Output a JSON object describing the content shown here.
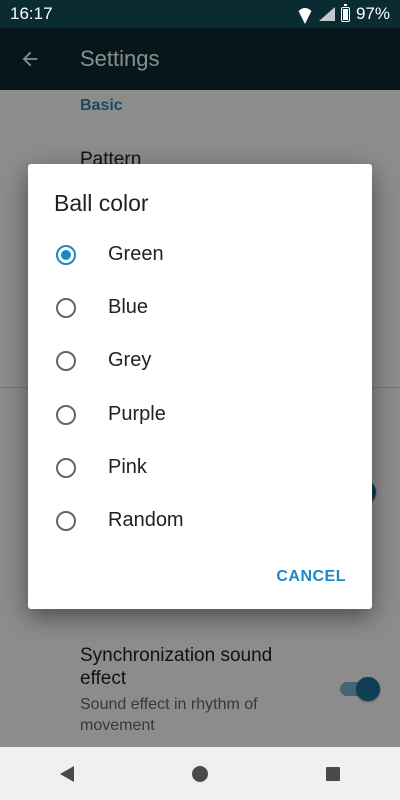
{
  "status_bar": {
    "time": "16:17",
    "battery": "97%"
  },
  "app_bar": {
    "title": "Settings"
  },
  "settings": {
    "section_basic": "Basic",
    "pattern_title": "Pattern",
    "sync_sound": {
      "title": "Synchronization sound effect",
      "summary": "Sound effect in rhythm of movement",
      "enabled": true
    }
  },
  "dialog": {
    "title": "Ball color",
    "options": [
      {
        "label": "Green",
        "selected": true
      },
      {
        "label": "Blue",
        "selected": false
      },
      {
        "label": "Grey",
        "selected": false
      },
      {
        "label": "Purple",
        "selected": false
      },
      {
        "label": "Pink",
        "selected": false
      },
      {
        "label": "Random",
        "selected": false
      }
    ],
    "cancel_label": "CANCEL"
  },
  "colors": {
    "app_bar": "#0b2b32",
    "accent": "#1a8ac4"
  }
}
